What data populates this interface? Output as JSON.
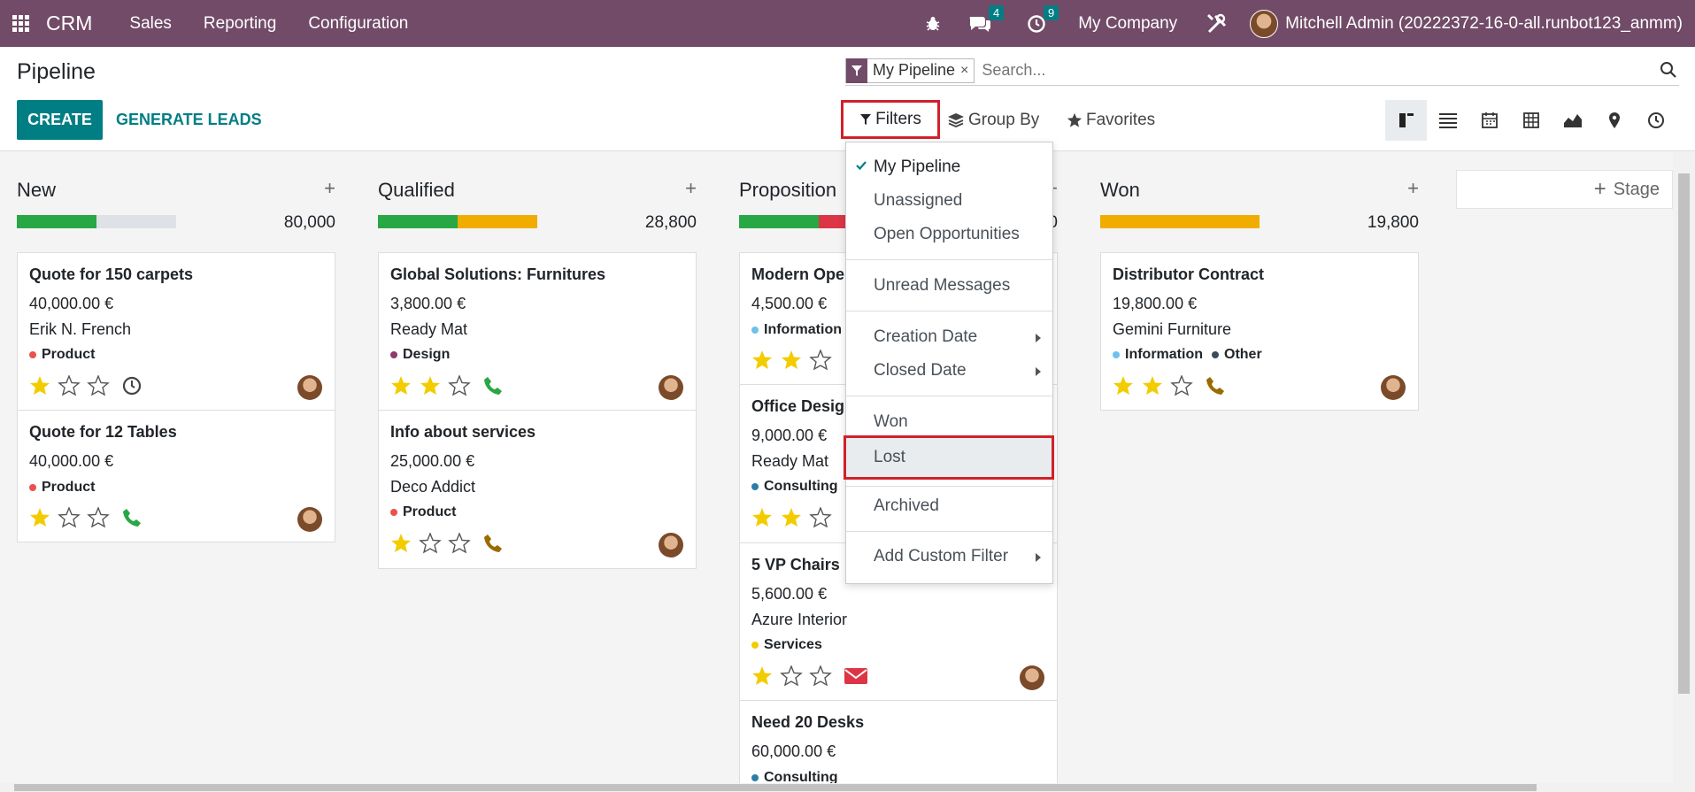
{
  "navbar": {
    "brand": "CRM",
    "menus": [
      "Sales",
      "Reporting",
      "Configuration"
    ],
    "messages_badge": "4",
    "activities_badge": "9",
    "company": "My Company",
    "user": "Mitchell Admin (20222372-16-0-all.runbot123_anmm)"
  },
  "control": {
    "breadcrumb": "Pipeline",
    "create_label": "CREATE",
    "generate_label": "GENERATE LEADS",
    "facet_label": "My Pipeline",
    "facet_remove": "×",
    "search_placeholder": "Search...",
    "filters_label": "Filters",
    "groupby_label": "Group By",
    "favorites_label": "Favorites"
  },
  "filters_menu": {
    "items": [
      "My Pipeline",
      "Unassigned",
      "Open Opportunities",
      "Unread Messages",
      "Creation Date",
      "Closed Date",
      "Won",
      "Lost",
      "Archived",
      "Add Custom Filter"
    ]
  },
  "kanban": {
    "columns": [
      {
        "title": "New",
        "amount": "80,000",
        "cards": [
          {
            "title": "Quote for 150 carpets",
            "amount": "40,000.00 €",
            "partner": "Erik N. French",
            "tags": [
              "Product"
            ],
            "stars": 1,
            "activity": "clock"
          },
          {
            "title": "Quote for 12 Tables",
            "amount": "40,000.00 €",
            "partner": "",
            "tags": [
              "Product"
            ],
            "stars": 1,
            "activity": "phone-green"
          }
        ]
      },
      {
        "title": "Qualified",
        "amount": "28,800",
        "cards": [
          {
            "title": "Global Solutions: Furnitures",
            "amount": "3,800.00 €",
            "partner": "Ready Mat",
            "tags": [
              "Design"
            ],
            "stars": 2,
            "activity": "phone-green"
          },
          {
            "title": "Info about services",
            "amount": "25,000.00 €",
            "partner": "Deco Addict",
            "tags": [
              "Product"
            ],
            "stars": 1,
            "activity": "phone-brown"
          }
        ]
      },
      {
        "title": "Proposition",
        "amount": "0",
        "cards": [
          {
            "title": "Modern Ope",
            "amount": "4,500.00 €",
            "partner": "",
            "tags": [
              "Information"
            ],
            "stars": 2,
            "activity": ""
          },
          {
            "title": "Office Desig",
            "amount": "9,000.00 €",
            "partner": "Ready Mat",
            "tags": [
              "Consulting"
            ],
            "stars": 2,
            "activity": ""
          },
          {
            "title": "5 VP Chairs",
            "amount": "5,600.00 €",
            "partner": "Azure Interior",
            "tags": [
              "Services"
            ],
            "stars": 1,
            "activity": "envelope"
          },
          {
            "title": "Need 20 Desks",
            "amount": "60,000.00 €",
            "partner": "",
            "tags": [
              "Consulting"
            ],
            "stars": 0,
            "activity": ""
          }
        ]
      },
      {
        "title": "Won",
        "amount": "19,800",
        "cards": [
          {
            "title": "Distributor Contract",
            "amount": "19,800.00 €",
            "partner": "Gemini Furniture",
            "tags": [
              "Information",
              "Other"
            ],
            "stars": 2,
            "activity": "phone-brown"
          }
        ]
      }
    ],
    "stage_add_label": "Stage"
  },
  "colors": {
    "navbar": "#714b67",
    "primary": "#017e84",
    "highlight": "#d0212b",
    "progress_green": "#28a745",
    "progress_orange": "#f0ad00",
    "progress_red": "#dc3545",
    "star": "#f3cc00"
  }
}
